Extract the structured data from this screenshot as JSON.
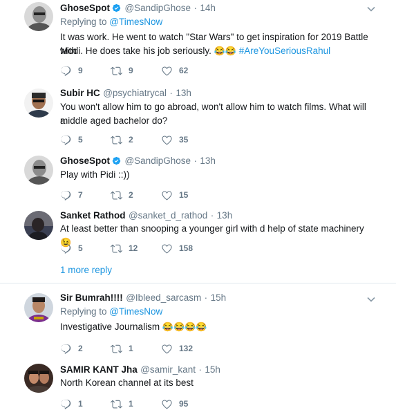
{
  "tweets": [
    {
      "name": "GhoseSpot",
      "verified": true,
      "handle": "@SandipGhose",
      "time": "14h",
      "replying_prefix": "Replying to ",
      "replying_to": "@TimesNow",
      "text": "It was work. He went to watch \"Star Wars\" to get inspiration for 2019 Battle with",
      "text_line2": "Modi. He does take his job seriously.",
      "emoji": "😂😂",
      "hashtag": "#AreYouSeriousRahul",
      "replies": "9",
      "retweets": "9",
      "likes": "62"
    },
    {
      "name": "Subir HC",
      "handle": "@psychiatrycal",
      "time": "13h",
      "text": "You won't allow him to go abroad, won't allow him to watch films. What will a",
      "text_line2": "middle aged bachelor do?",
      "replies": "5",
      "retweets": "2",
      "likes": "35"
    },
    {
      "name": "GhoseSpot",
      "verified": true,
      "handle": "@SandipGhose",
      "time": "13h",
      "text": "Play with Pidi ::))",
      "replies": "7",
      "retweets": "2",
      "likes": "15"
    },
    {
      "name": "Sanket Rathod",
      "handle": "@sanket_d_rathod",
      "time": "13h",
      "text": "At least better than snooping a younger girl with d help of state machinery",
      "emoji": "😉",
      "replies": "5",
      "retweets": "12",
      "likes": "158"
    },
    {
      "name": "Sir Bumrah!!!!",
      "handle": "@Ibleed_sarcasm",
      "time": "15h",
      "replying_prefix": "Replying to ",
      "replying_to": "@TimesNow",
      "text": "Investigative Journalism",
      "emoji": "😂😂😂😂",
      "replies": "2",
      "retweets": "1",
      "likes": "132"
    },
    {
      "name": "SAMIR KANT Jha",
      "handle": "@samir_kant",
      "time": "15h",
      "text": "North Korean channel at its best",
      "replies": "1",
      "retweets": "1",
      "likes": "95"
    }
  ],
  "more_reply": "1 more reply",
  "separator_dot": "·",
  "colors": {
    "link": "#1b95e0",
    "secondary": "#657786",
    "text": "#14171a",
    "verified": "#1da1f2"
  },
  "icons": {
    "reply": "reply-icon",
    "retweet": "retweet-icon",
    "like": "heart-icon",
    "caret": "chevron-down-icon",
    "verified": "verified-badge-icon"
  }
}
